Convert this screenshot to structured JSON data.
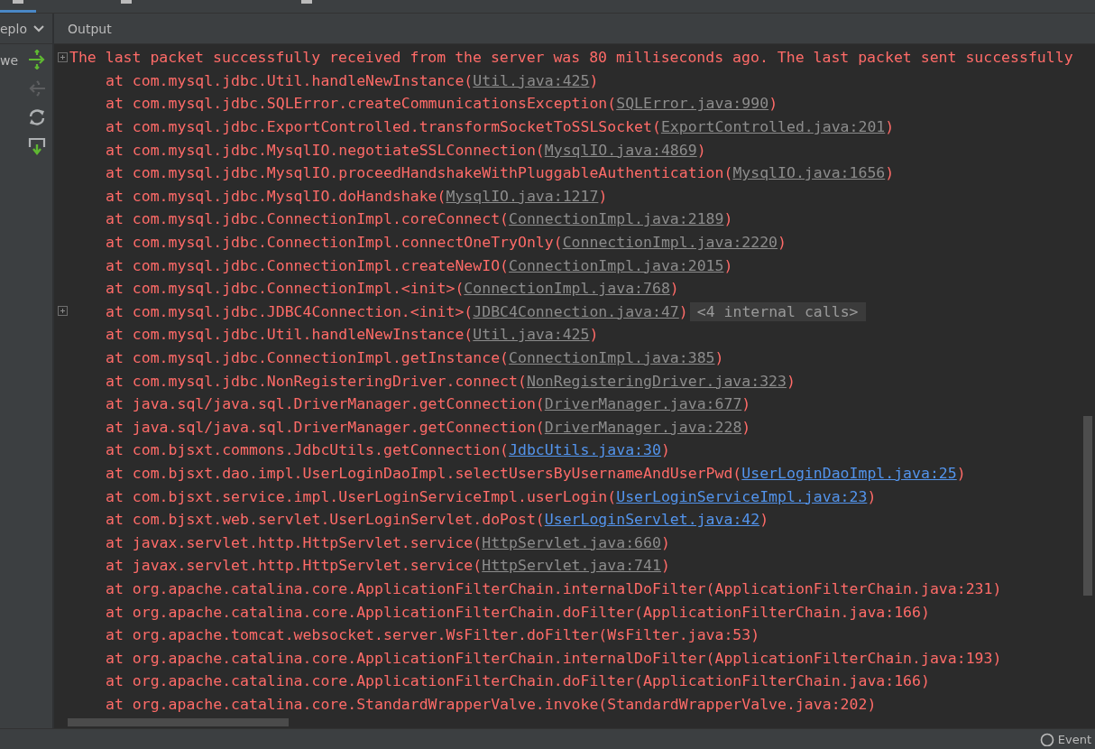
{
  "tabs": [
    {
      "selected": true
    },
    {
      "selected": false
    },
    {
      "selected": false
    }
  ],
  "panel": {
    "header": "eplo",
    "node": "we",
    "tools": [
      {
        "kind": "deploy",
        "disabled": false
      },
      {
        "kind": "undeploy",
        "disabled": true
      },
      {
        "kind": "refresh",
        "disabled": false
      },
      {
        "kind": "dump",
        "disabled": false
      }
    ]
  },
  "output": {
    "title": "Output",
    "lines": [
      {
        "kind": "message",
        "text_before": "The last packet successfully received from the server was 80 milliseconds ago.  The last packet sent successfully",
        "foldable": true
      },
      {
        "kind": "frame",
        "text_before": "at com.mysql.jdbc.Util.handleNewInstance(",
        "location": "Util.java:425",
        "project": false,
        "text_after": ")",
        "foldable": false
      },
      {
        "kind": "frame",
        "text_before": "at com.mysql.jdbc.SQLError.createCommunicationsException(",
        "location": "SQLError.java:990",
        "project": false,
        "text_after": ")",
        "foldable": false
      },
      {
        "kind": "frame",
        "text_before": "at com.mysql.jdbc.ExportControlled.transformSocketToSSLSocket(",
        "location": "ExportControlled.java:201",
        "project": false,
        "text_after": ")",
        "foldable": false
      },
      {
        "kind": "frame",
        "text_before": "at com.mysql.jdbc.MysqlIO.negotiateSSLConnection(",
        "location": "MysqlIO.java:4869",
        "project": false,
        "text_after": ")",
        "foldable": false
      },
      {
        "kind": "frame",
        "text_before": "at com.mysql.jdbc.MysqlIO.proceedHandshakeWithPluggableAuthentication(",
        "location": "MysqlIO.java:1656",
        "project": false,
        "text_after": ")",
        "foldable": false
      },
      {
        "kind": "frame",
        "text_before": "at com.mysql.jdbc.MysqlIO.doHandshake(",
        "location": "MysqlIO.java:1217",
        "project": false,
        "text_after": ")",
        "foldable": false
      },
      {
        "kind": "frame",
        "text_before": "at com.mysql.jdbc.ConnectionImpl.coreConnect(",
        "location": "ConnectionImpl.java:2189",
        "project": false,
        "text_after": ")",
        "foldable": false
      },
      {
        "kind": "frame",
        "text_before": "at com.mysql.jdbc.ConnectionImpl.connectOneTryOnly(",
        "location": "ConnectionImpl.java:2220",
        "project": false,
        "text_after": ")",
        "foldable": false
      },
      {
        "kind": "frame",
        "text_before": "at com.mysql.jdbc.ConnectionImpl.createNewIO(",
        "location": "ConnectionImpl.java:2015",
        "project": false,
        "text_after": ")",
        "foldable": false
      },
      {
        "kind": "frame",
        "text_before": "at com.mysql.jdbc.ConnectionImpl.<init>(",
        "location": "ConnectionImpl.java:768",
        "project": false,
        "text_after": ")",
        "foldable": false
      },
      {
        "kind": "frame",
        "text_before": "at com.mysql.jdbc.JDBC4Connection.<init>(",
        "location": "JDBC4Connection.java:47",
        "project": false,
        "text_after": ")",
        "note": "<4 internal calls>",
        "foldable": true
      },
      {
        "kind": "frame",
        "text_before": "at com.mysql.jdbc.Util.handleNewInstance(",
        "location": "Util.java:425",
        "project": false,
        "text_after": ")",
        "foldable": false
      },
      {
        "kind": "frame",
        "text_before": "at com.mysql.jdbc.ConnectionImpl.getInstance(",
        "location": "ConnectionImpl.java:385",
        "project": false,
        "text_after": ")",
        "foldable": false
      },
      {
        "kind": "frame",
        "text_before": "at com.mysql.jdbc.NonRegisteringDriver.connect(",
        "location": "NonRegisteringDriver.java:323",
        "project": false,
        "text_after": ")",
        "foldable": false
      },
      {
        "kind": "frame",
        "text_before": "at java.sql/java.sql.DriverManager.getConnection(",
        "location": "DriverManager.java:677",
        "project": false,
        "text_after": ")",
        "foldable": false
      },
      {
        "kind": "frame",
        "text_before": "at java.sql/java.sql.DriverManager.getConnection(",
        "location": "DriverManager.java:228",
        "project": false,
        "text_after": ")",
        "foldable": false
      },
      {
        "kind": "frame",
        "text_before": "at com.bjsxt.commons.JdbcUtils.getConnection(",
        "location": "JdbcUtils.java:30",
        "project": true,
        "text_after": ")",
        "foldable": false
      },
      {
        "kind": "frame",
        "text_before": "at com.bjsxt.dao.impl.UserLoginDaoImpl.selectUsersByUsernameAndUserPwd(",
        "location": "UserLoginDaoImpl.java:25",
        "project": true,
        "text_after": ")",
        "foldable": false
      },
      {
        "kind": "frame",
        "text_before": "at com.bjsxt.service.impl.UserLoginServiceImpl.userLogin(",
        "location": "UserLoginServiceImpl.java:23",
        "project": true,
        "text_after": ")",
        "foldable": false
      },
      {
        "kind": "frame",
        "text_before": "at com.bjsxt.web.servlet.UserLoginServlet.doPost(",
        "location": "UserLoginServlet.java:42",
        "project": true,
        "text_after": ")",
        "foldable": false
      },
      {
        "kind": "frame",
        "text_before": "at javax.servlet.http.HttpServlet.service(",
        "location": "HttpServlet.java:660",
        "project": false,
        "text_after": ")",
        "foldable": false
      },
      {
        "kind": "frame",
        "text_before": "at javax.servlet.http.HttpServlet.service(",
        "location": "HttpServlet.java:741",
        "project": false,
        "text_after": ")",
        "foldable": false
      },
      {
        "kind": "frame",
        "text_before": "at org.apache.catalina.core.ApplicationFilterChain.internalDoFilter(ApplicationFilterChain.java:231)",
        "foldable": false
      },
      {
        "kind": "frame",
        "text_before": "at org.apache.catalina.core.ApplicationFilterChain.doFilter(ApplicationFilterChain.java:166)",
        "foldable": false
      },
      {
        "kind": "frame",
        "text_before": "at org.apache.tomcat.websocket.server.WsFilter.doFilter(WsFilter.java:53)",
        "foldable": false
      },
      {
        "kind": "frame",
        "text_before": "at org.apache.catalina.core.ApplicationFilterChain.internalDoFilter(ApplicationFilterChain.java:193)",
        "foldable": false
      },
      {
        "kind": "frame",
        "text_before": "at org.apache.catalina.core.ApplicationFilterChain.doFilter(ApplicationFilterChain.java:166)",
        "foldable": false
      },
      {
        "kind": "frame",
        "text_before": "at org.apache.catalina.core.StandardWrapperValve.invoke(StandardWrapperValve.java:202)",
        "foldable": false
      }
    ]
  },
  "status_bar": {
    "event": "Event"
  }
}
